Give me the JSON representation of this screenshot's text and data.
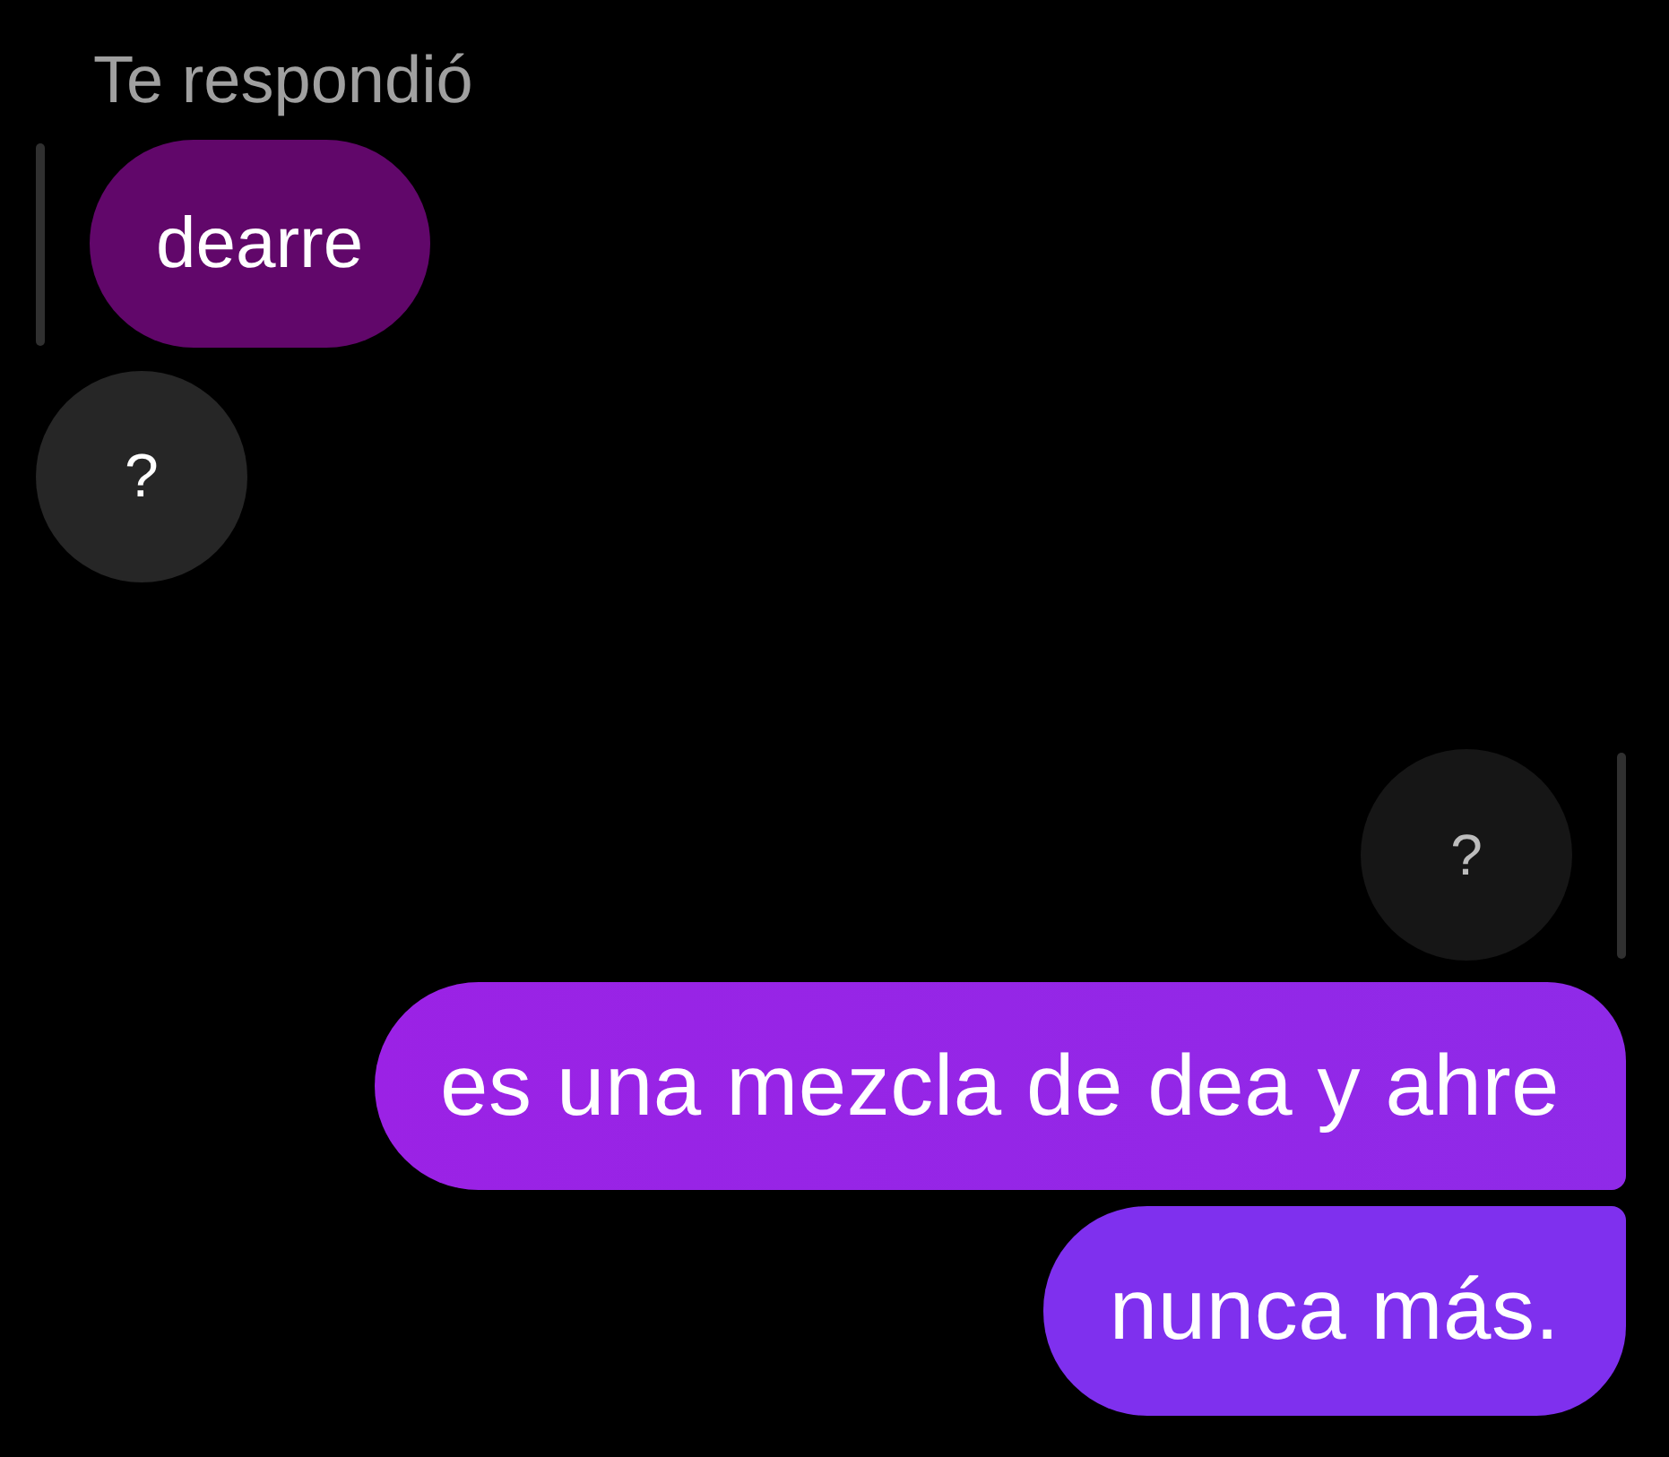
{
  "messages": [
    {
      "outgoing": false,
      "reply_label": "Te respondió",
      "quoted": "dearre",
      "text": "?"
    },
    {
      "outgoing": true,
      "quoted": "?",
      "text": "es una mezcla de dea y ahre"
    },
    {
      "outgoing": true,
      "text": "nunca más."
    }
  ]
}
